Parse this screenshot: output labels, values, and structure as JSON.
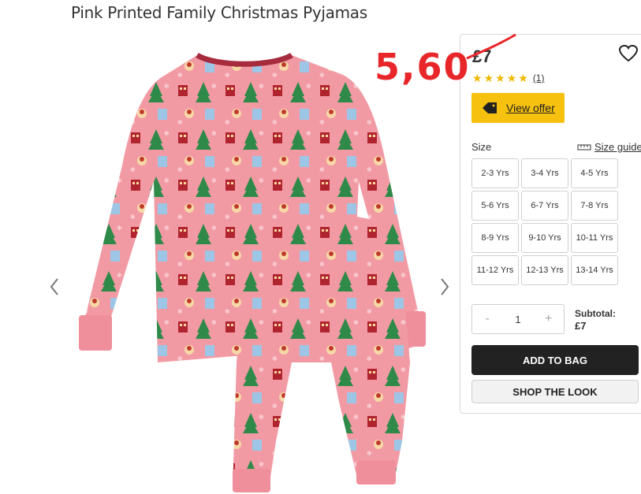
{
  "page": {
    "title": "Pink Printed Family Christmas Pyjamas"
  },
  "annotation": {
    "text": "5,60"
  },
  "product": {
    "price": "£7",
    "rating": 5,
    "review_count": "(1)",
    "offer_label": "View offer",
    "size_label": "Size",
    "size_guide_label": "Size guide",
    "sizes": [
      "2-3 Yrs",
      "3-4 Yrs",
      "4-5 Yrs",
      "5-6 Yrs",
      "6-7 Yrs",
      "7-8 Yrs",
      "8-9 Yrs",
      "9-10 Yrs",
      "10-11 Yrs",
      "11-12 Yrs",
      "12-13 Yrs",
      "13-14 Yrs"
    ],
    "quantity": {
      "minus": "-",
      "value": "1",
      "plus": "+"
    },
    "subtotal_label": "Subtotal:",
    "subtotal_value": "£7",
    "add_to_bag": "ADD TO BAG",
    "shop_the_look": "SHOP THE LOOK"
  },
  "colors": {
    "pyjama_pink": "#f29aa4",
    "offer_yellow": "#f7c10f",
    "annotation_red": "#e8262a",
    "star_gold": "#f0b800"
  },
  "icons": {
    "prev": "chevron-left-icon",
    "next": "chevron-right-icon",
    "wishlist": "heart-icon",
    "offer": "price-tag-icon",
    "size_guide": "ruler-icon"
  }
}
